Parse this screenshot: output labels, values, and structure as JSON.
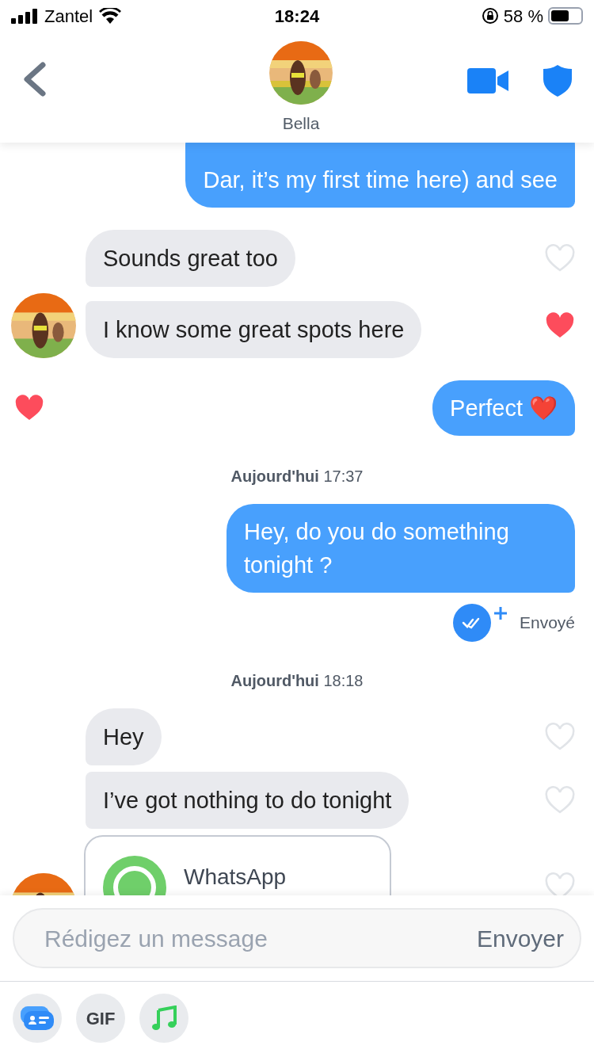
{
  "status_bar": {
    "carrier": "Zantel",
    "time": "18:24",
    "battery": "58 %"
  },
  "header": {
    "name": "Bella"
  },
  "messages": [
    {
      "kind": "sent",
      "text": "Dar, it’s my first time here) and see",
      "liked": false
    },
    {
      "kind": "received",
      "text": "Sounds great too",
      "liked": false,
      "avatar": false
    },
    {
      "kind": "received",
      "text": "I know some great spots here",
      "liked": true,
      "avatar": true
    },
    {
      "kind": "sent",
      "text": "Perfect ❤️",
      "liked": true
    },
    {
      "kind": "date",
      "text": "**Aujourd'hui** 17:37"
    },
    {
      "kind": "sent",
      "text": "Hey, do you do something tonight ?",
      "liked": false
    },
    {
      "kind": "status",
      "text": "Envoyé"
    },
    {
      "kind": "date",
      "text": "**Aujourd'hui** 18:18"
    },
    {
      "kind": "received",
      "text": "Hey",
      "liked": false,
      "avatar": false
    },
    {
      "kind": "received",
      "text": "I’ve got nothing to do tonight",
      "liked": false,
      "avatar": false
    },
    {
      "kind": "card",
      "text": "WhatsApp",
      "liked": false,
      "avatar": true
    }
  ],
  "composer": {
    "placeholder": "Rédigez un message",
    "send": "Envoyer"
  },
  "tools": [
    {
      "kind": "stickers"
    },
    {
      "kind": "gif",
      "label": "GIF"
    },
    {
      "kind": "music"
    }
  ]
}
